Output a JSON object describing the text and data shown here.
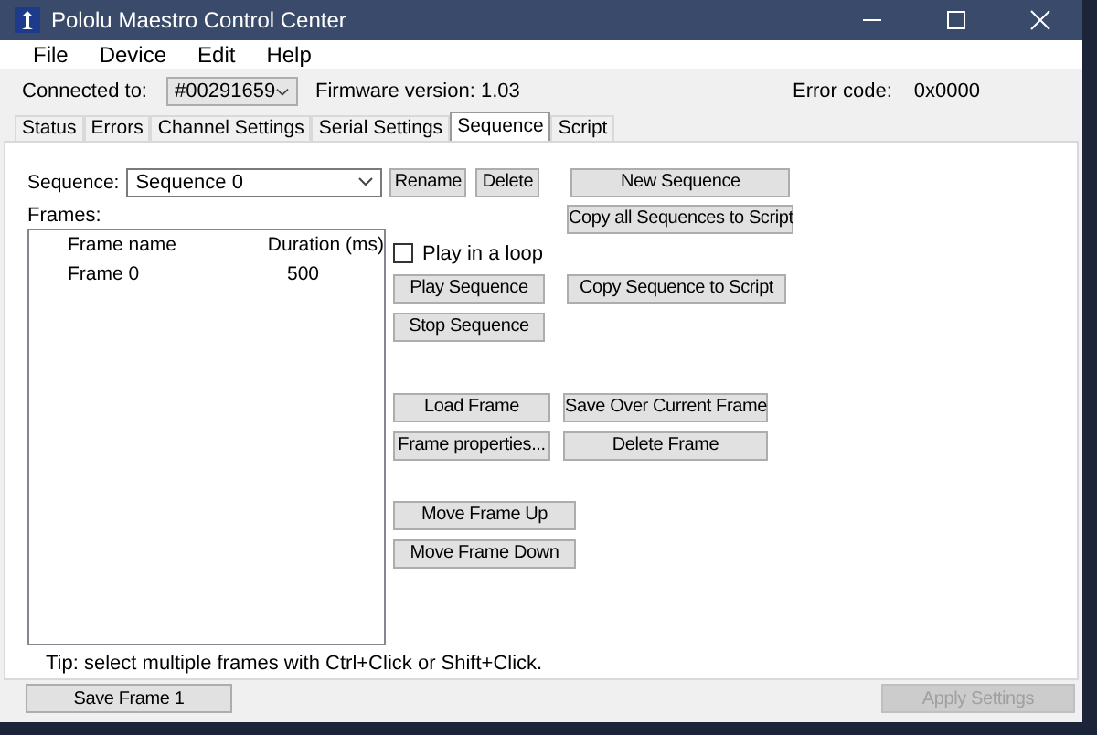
{
  "window": {
    "title": "Pololu Maestro Control Center"
  },
  "menu": [
    "File",
    "Device",
    "Edit",
    "Help"
  ],
  "device_bar": {
    "connected_label": "Connected to:",
    "device": "#00291659",
    "firmware": "Firmware version: 1.03",
    "error_label": "Error code:",
    "error_code": "0x0000"
  },
  "tabs": [
    {
      "label": "Status",
      "selected": false
    },
    {
      "label": "Errors",
      "selected": false
    },
    {
      "label": "Channel Settings",
      "selected": false
    },
    {
      "label": "Serial Settings",
      "selected": false
    },
    {
      "label": "Sequence",
      "selected": true
    },
    {
      "label": "Script",
      "selected": false
    }
  ],
  "sequence": {
    "label": "Sequence:",
    "value": "Sequence 0",
    "rename": "Rename",
    "delete": "Delete",
    "new": "New Sequence",
    "copy_all": "Copy all Sequences to Script"
  },
  "frames": {
    "label": "Frames:",
    "columns": [
      "Frame name",
      "Duration (ms)"
    ],
    "rows": [
      {
        "name": "Frame 0",
        "duration": "500"
      }
    ],
    "tip": "Tip: select multiple frames with Ctrl+Click or Shift+Click."
  },
  "play_in_loop": {
    "label": "Play in a loop",
    "checked": false
  },
  "buttons": {
    "play": "Play Sequence",
    "copy_sequence": "Copy Sequence to Script",
    "stop": "Stop Sequence",
    "load": "Load Frame",
    "save_over": "Save Over Current Frame",
    "properties": "Frame properties...",
    "delete_frame": "Delete Frame",
    "move_up": "Move Frame Up",
    "move_down": "Move Frame Down"
  },
  "footer": {
    "save_frame": {
      "label": "Save Frame 1",
      "disabled": false
    },
    "apply": {
      "label": "Apply Settings",
      "disabled": true
    }
  }
}
